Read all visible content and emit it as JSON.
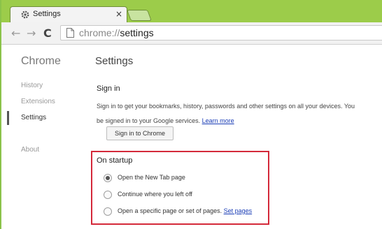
{
  "tab": {
    "title": "Settings",
    "close": "×"
  },
  "toolbar": {
    "back": "←",
    "forward": "→",
    "reload": "C",
    "url_scheme": "chrome://",
    "url_host": "settings"
  },
  "sidebar": {
    "title": "Chrome",
    "items": [
      {
        "label": "History"
      },
      {
        "label": "Extensions"
      },
      {
        "label": "Settings"
      },
      {
        "label": "About"
      }
    ]
  },
  "main": {
    "title": "Settings",
    "signin": {
      "heading": "Sign in",
      "line1": "Sign in to get your bookmarks, history, passwords and other settings on all your devices. You",
      "line2": "be signed in to your Google services.",
      "learn_more": "Learn more",
      "button": "Sign in to Chrome"
    },
    "startup": {
      "heading": "On startup",
      "options": [
        {
          "label": "Open the New Tab page",
          "checked": true
        },
        {
          "label": "Continue where you left off",
          "checked": false
        },
        {
          "label": "Open a specific page or set of pages.",
          "link": "Set pages",
          "checked": false
        }
      ]
    }
  },
  "colors": {
    "highlight_border": "#d4293a",
    "tabstrip": "#9ccc4a",
    "link": "#1a3db6"
  }
}
